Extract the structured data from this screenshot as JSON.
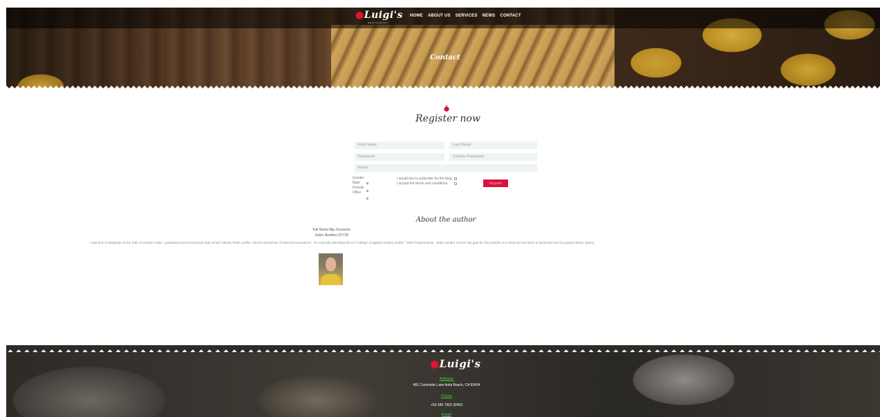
{
  "header": {
    "logo": "Luigi's",
    "logo_sub": "RESTAURANT",
    "nav": [
      "HOME",
      "ABOUT US",
      "SERVICES",
      "NEWS",
      "CONTACT"
    ],
    "hero_title": "Contact"
  },
  "register": {
    "title": "Register now",
    "first_name_placeholder": "First Name",
    "last_name_placeholder": "Last Name",
    "password_placeholder": "Password",
    "confirm_password_placeholder": "Confirm Password",
    "email_placeholder": "Email",
    "gender_label": "Gender",
    "gender_options": [
      "Male",
      "Female",
      "Other"
    ],
    "terms_text": "I would like to subscribe for the blog. I accept the terms and conditions",
    "submit_label": "Register"
  },
  "about": {
    "title": "About the author",
    "full_name": "Full Name:Ilija Jovanovic",
    "index_number": "Index Number:127/18",
    "bio": "I was born in Belgrade on the 29th of October 1998. I graduated electro-technical high school \"Nikola Tesla\" profile: \"Electro-technician of telecommunications\". I'm currently attending the ICT College of applied studies, profile: \"Web Programming\", index number 127/18. My goal for this website is to show the functions of javascript and its popular library Jquery."
  },
  "footer": {
    "logo": "Luigi's",
    "address_label": "Address",
    "address_value": "481 Creekside Lane Avila Beach, CA 93424",
    "phone_label": "Phone",
    "phone_value": "+53 345 7953 32453",
    "email_label": "Email"
  },
  "colors": {
    "accent": "#d8123a",
    "footer_link": "#3ad63a",
    "field_bg": "#eef3f4"
  }
}
